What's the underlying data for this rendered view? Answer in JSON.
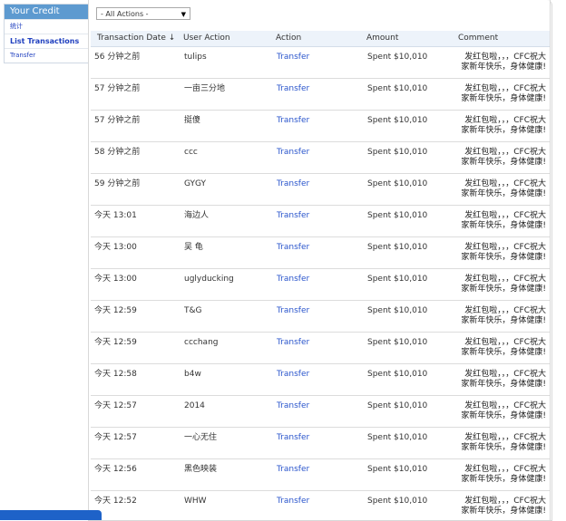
{
  "sidebar": {
    "title": "Your Credit",
    "items": [
      {
        "label": "统计"
      },
      {
        "label": "List Transactions"
      },
      {
        "label": "Transfer"
      }
    ]
  },
  "filter": {
    "selected": "- All Actions -"
  },
  "table": {
    "headers": [
      "Transaction Date ↓",
      "User Action",
      "Action",
      "Amount",
      "Comment"
    ],
    "comment_line1": "发红包啦，，，CFC祝大",
    "comment_line2": "家新年快乐，身体健康!",
    "rows": [
      {
        "date": "56 分钟之前",
        "user": "tulips",
        "action": "Transfer",
        "amount": "Spent $10,010"
      },
      {
        "date": "57 分钟之前",
        "user": "一亩三分地",
        "action": "Transfer",
        "amount": "Spent $10,010"
      },
      {
        "date": "57 分钟之前",
        "user": "挺傻",
        "action": "Transfer",
        "amount": "Spent $10,010"
      },
      {
        "date": "58 分钟之前",
        "user": "ccc",
        "action": "Transfer",
        "amount": "Spent $10,010"
      },
      {
        "date": "59 分钟之前",
        "user": "GYGY",
        "action": "Transfer",
        "amount": "Spent $10,010"
      },
      {
        "date": "今天 13:01",
        "user": "海边人",
        "action": "Transfer",
        "amount": "Spent $10,010"
      },
      {
        "date": "今天 13:00",
        "user": "吴 龟",
        "action": "Transfer",
        "amount": "Spent $10,010"
      },
      {
        "date": "今天 13:00",
        "user": "uglyducking",
        "action": "Transfer",
        "amount": "Spent $10,010"
      },
      {
        "date": "今天 12:59",
        "user": "T&G",
        "action": "Transfer",
        "amount": "Spent $10,010"
      },
      {
        "date": "今天 12:59",
        "user": "ccchang",
        "action": "Transfer",
        "amount": "Spent $10,010"
      },
      {
        "date": "今天 12:58",
        "user": "b4w",
        "action": "Transfer",
        "amount": "Spent $10,010"
      },
      {
        "date": "今天 12:57",
        "user": "2014",
        "action": "Transfer",
        "amount": "Spent $10,010"
      },
      {
        "date": "今天 12:57",
        "user": "一心无住",
        "action": "Transfer",
        "amount": "Spent $10,010"
      },
      {
        "date": "今天 12:56",
        "user": "黑色映装",
        "action": "Transfer",
        "amount": "Spent $10,010"
      },
      {
        "date": "今天 12:52",
        "user": "WHW",
        "action": "Transfer",
        "amount": "Spent $10,010"
      }
    ]
  }
}
